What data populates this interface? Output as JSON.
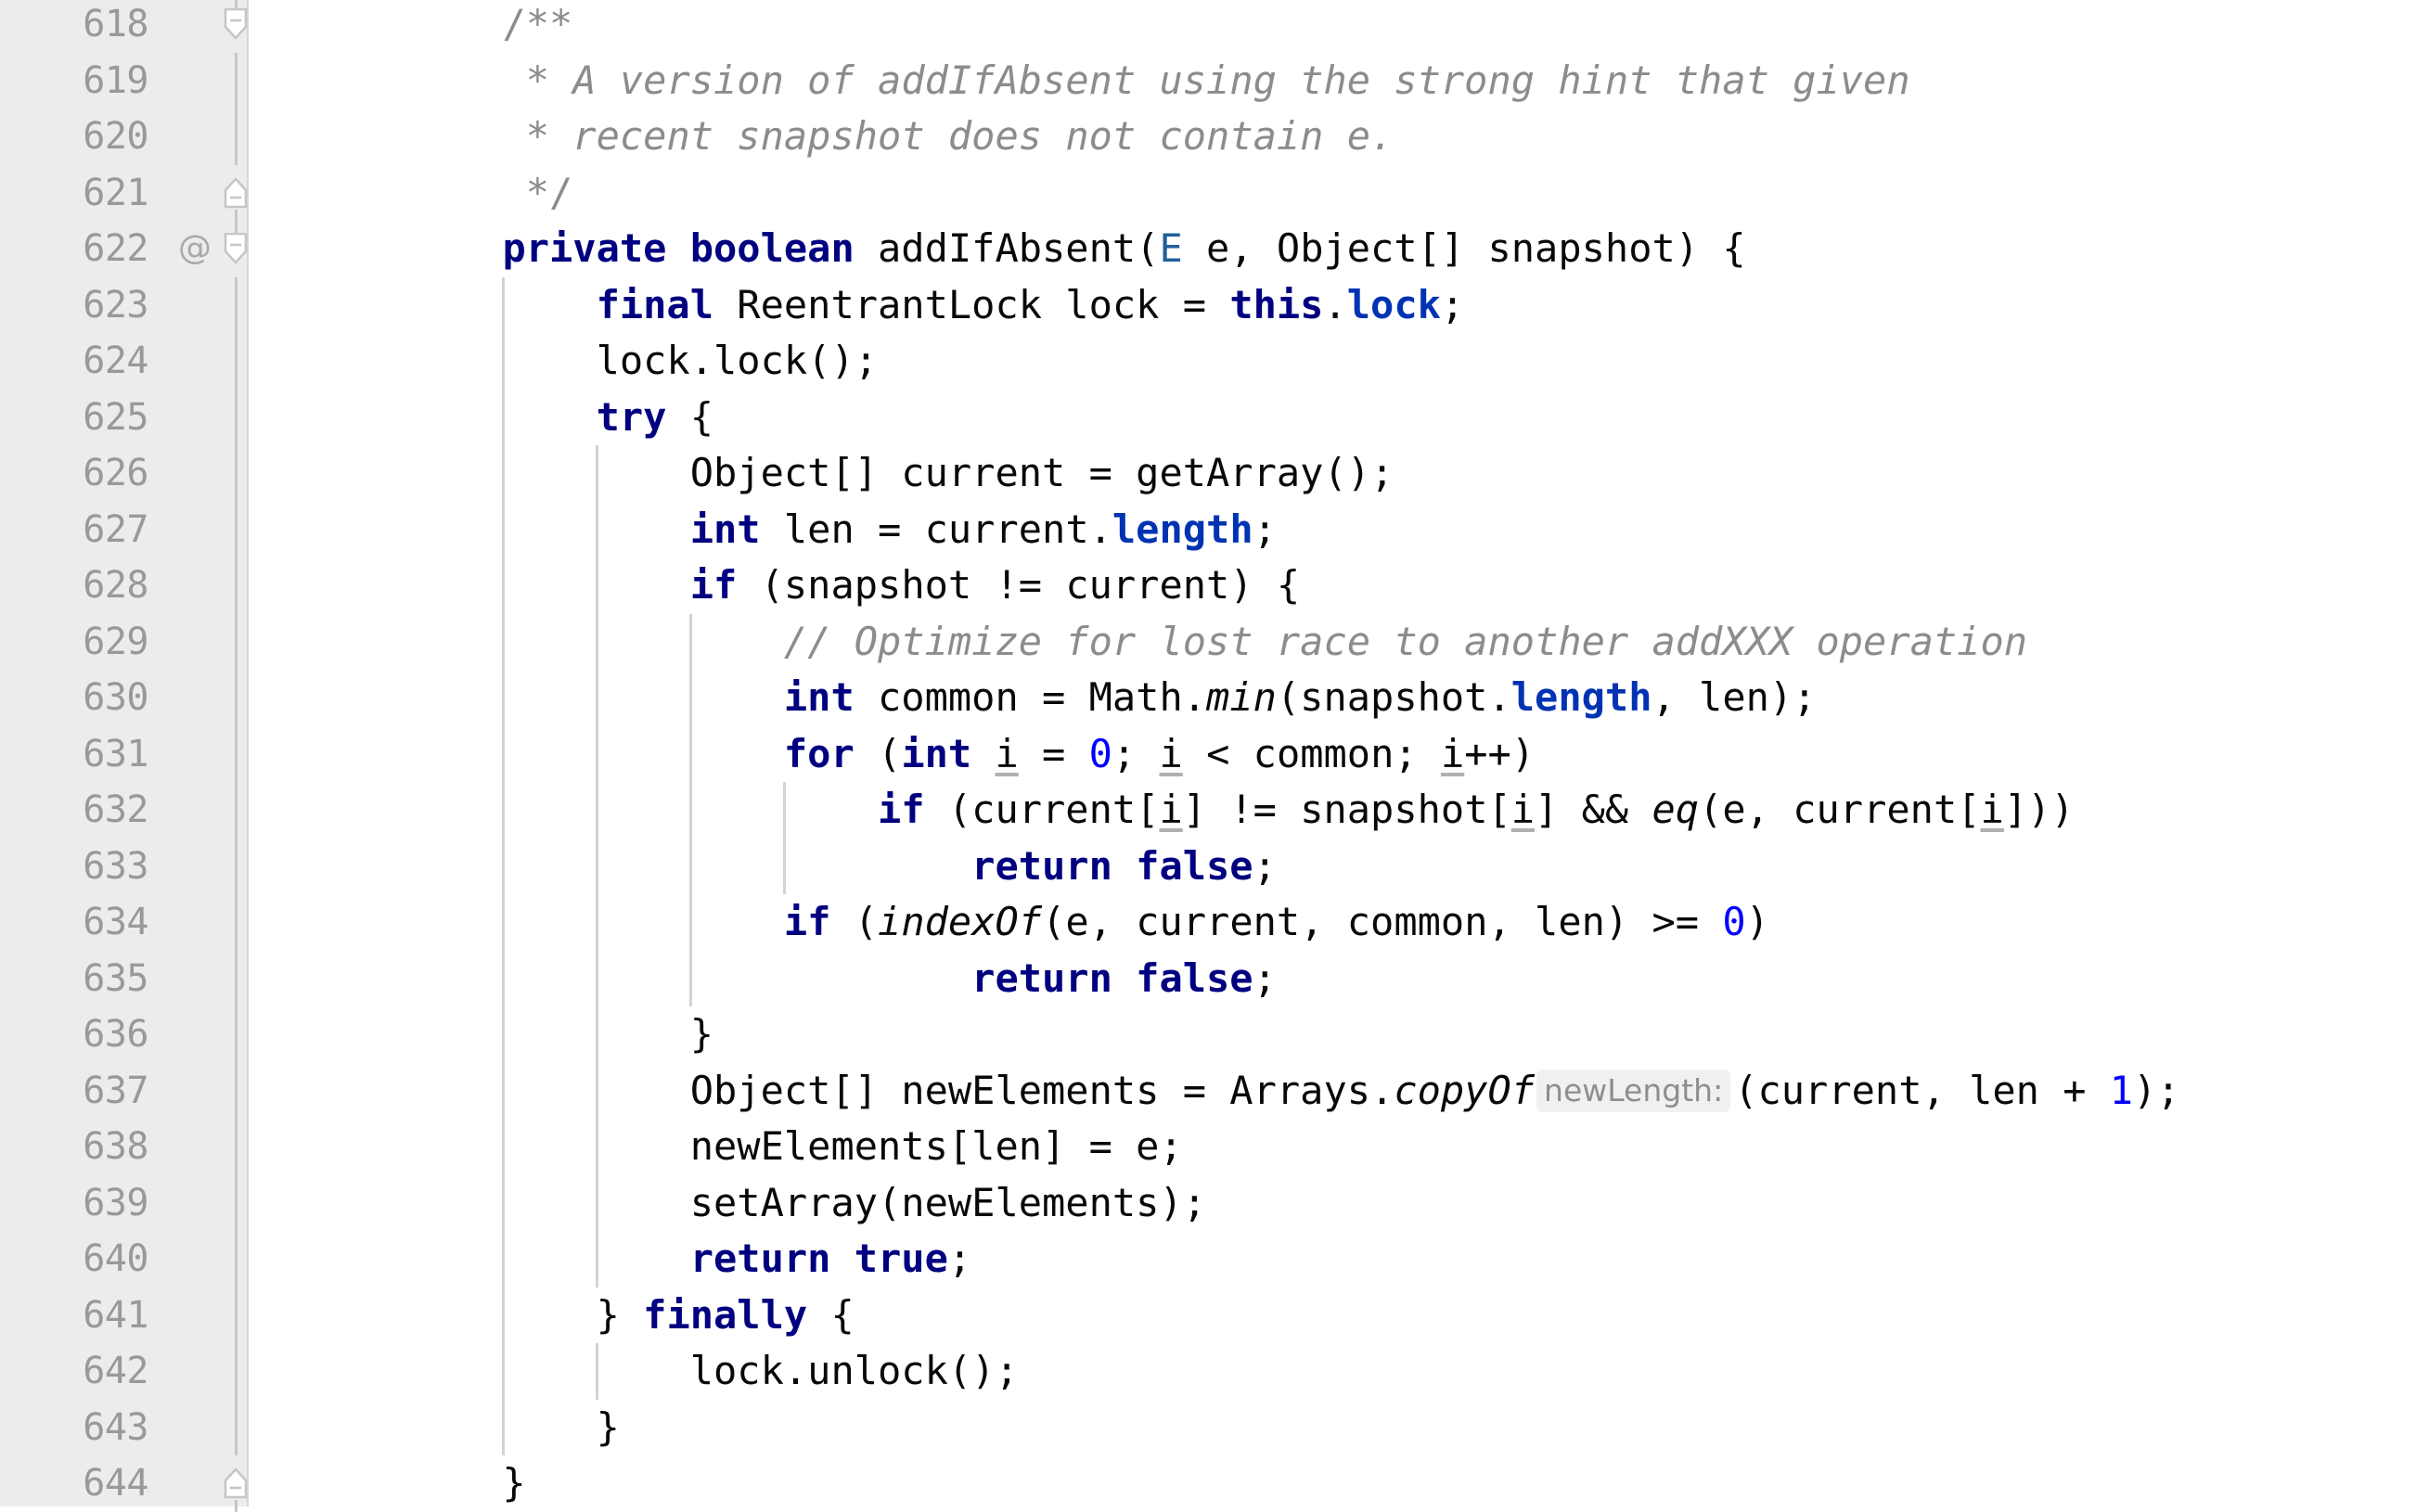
{
  "editor": {
    "language": "java",
    "theme": "light",
    "colors": {
      "gutter_bg": "#ececec",
      "gutter_fg": "#999999",
      "code_bg": "#ffffff",
      "code_fg": "#080808",
      "keyword": "#000080",
      "comment": "#8c8c8c",
      "number": "#0000ff",
      "field": "#0033b3",
      "type_parameter": "#20609a",
      "indent_guide": "#d3d3d3",
      "fold_marker": "#c6c6c6",
      "inlay_bg": "#f0f0f0",
      "inlay_fg": "#8e8e8e"
    },
    "first_line_number": 618,
    "last_line_number": 644,
    "gutter_markers": {
      "annotation_icon": "@",
      "annotation_icon_line": 622,
      "fold_minus_icon": "−"
    },
    "lines": [
      {
        "number": "618",
        "indent_guides": [],
        "fold": "start-down",
        "at": false,
        "tokens": [
          {
            "t": "            ",
            "c": "plain"
          },
          {
            "t": "/**",
            "c": "cmt-nb"
          }
        ]
      },
      {
        "number": "619",
        "indent_guides": [],
        "fold": "line",
        "at": false,
        "tokens": [
          {
            "t": "             ",
            "c": "plain"
          },
          {
            "t": "* A version of addIfAbsent using the strong hint that given",
            "c": "cmt"
          }
        ]
      },
      {
        "number": "620",
        "indent_guides": [],
        "fold": "line",
        "at": false,
        "tokens": [
          {
            "t": "             ",
            "c": "plain"
          },
          {
            "t": "* recent snapshot does not contain e.",
            "c": "cmt"
          }
        ]
      },
      {
        "number": "621",
        "indent_guides": [],
        "fold": "end-up",
        "at": false,
        "tokens": [
          {
            "t": "             ",
            "c": "plain"
          },
          {
            "t": "*/",
            "c": "cmt-nb"
          }
        ]
      },
      {
        "number": "622",
        "indent_guides": [],
        "fold": "start-down",
        "at": true,
        "tokens": [
          {
            "t": "            ",
            "c": "plain"
          },
          {
            "t": "private boolean",
            "c": "kw"
          },
          {
            "t": " addIfAbsent(",
            "c": "plain"
          },
          {
            "t": "E",
            "c": "typaram"
          },
          {
            "t": " e, Object[] snapshot) {",
            "c": "plain"
          }
        ]
      },
      {
        "number": "623",
        "indent_guides": [
          1
        ],
        "fold": "line",
        "at": false,
        "tokens": [
          {
            "t": "                ",
            "c": "plain"
          },
          {
            "t": "final",
            "c": "kw"
          },
          {
            "t": " ReentrantLock lock = ",
            "c": "plain"
          },
          {
            "t": "this",
            "c": "kw"
          },
          {
            "t": ".",
            "c": "plain"
          },
          {
            "t": "lock",
            "c": "field"
          },
          {
            "t": ";",
            "c": "plain"
          }
        ]
      },
      {
        "number": "624",
        "indent_guides": [
          1
        ],
        "fold": "line",
        "at": false,
        "tokens": [
          {
            "t": "                lock.lock();",
            "c": "plain"
          }
        ]
      },
      {
        "number": "625",
        "indent_guides": [
          1
        ],
        "fold": "line",
        "at": false,
        "tokens": [
          {
            "t": "                ",
            "c": "plain"
          },
          {
            "t": "try",
            "c": "kw"
          },
          {
            "t": " {",
            "c": "plain"
          }
        ]
      },
      {
        "number": "626",
        "indent_guides": [
          1,
          2
        ],
        "fold": "line",
        "at": false,
        "tokens": [
          {
            "t": "                    Object[] current = getArray();",
            "c": "plain"
          }
        ]
      },
      {
        "number": "627",
        "indent_guides": [
          1,
          2
        ],
        "fold": "line",
        "at": false,
        "tokens": [
          {
            "t": "                    ",
            "c": "plain"
          },
          {
            "t": "int",
            "c": "kw"
          },
          {
            "t": " len = current.",
            "c": "plain"
          },
          {
            "t": "length",
            "c": "field"
          },
          {
            "t": ";",
            "c": "plain"
          }
        ]
      },
      {
        "number": "628",
        "indent_guides": [
          1,
          2
        ],
        "fold": "line",
        "at": false,
        "tokens": [
          {
            "t": "                    ",
            "c": "plain"
          },
          {
            "t": "if",
            "c": "kw"
          },
          {
            "t": " (snapshot != current) {",
            "c": "plain"
          }
        ]
      },
      {
        "number": "629",
        "indent_guides": [
          1,
          2,
          3
        ],
        "fold": "line",
        "at": false,
        "tokens": [
          {
            "t": "                        ",
            "c": "plain"
          },
          {
            "t": "// Optimize for lost race to another addXXX operation",
            "c": "cmt"
          }
        ]
      },
      {
        "number": "630",
        "indent_guides": [
          1,
          2,
          3
        ],
        "fold": "line",
        "at": false,
        "tokens": [
          {
            "t": "                        ",
            "c": "plain"
          },
          {
            "t": "int",
            "c": "kw"
          },
          {
            "t": " common = Math.",
            "c": "plain"
          },
          {
            "t": "min",
            "c": "statm"
          },
          {
            "t": "(snapshot.",
            "c": "plain"
          },
          {
            "t": "length",
            "c": "field"
          },
          {
            "t": ", len);",
            "c": "plain"
          }
        ]
      },
      {
        "number": "631",
        "indent_guides": [
          1,
          2,
          3
        ],
        "fold": "line",
        "at": false,
        "tokens": [
          {
            "t": "                        ",
            "c": "plain"
          },
          {
            "t": "for",
            "c": "kw"
          },
          {
            "t": " (",
            "c": "plain"
          },
          {
            "t": "int",
            "c": "kw"
          },
          {
            "t": " ",
            "c": "plain"
          },
          {
            "t": "i",
            "c": "localv"
          },
          {
            "t": " = ",
            "c": "plain"
          },
          {
            "t": "0",
            "c": "num"
          },
          {
            "t": "; ",
            "c": "plain"
          },
          {
            "t": "i",
            "c": "localv"
          },
          {
            "t": " < common; ",
            "c": "plain"
          },
          {
            "t": "i",
            "c": "localv"
          },
          {
            "t": "++)",
            "c": "plain"
          }
        ]
      },
      {
        "number": "632",
        "indent_guides": [
          1,
          2,
          3,
          4
        ],
        "fold": "line",
        "at": false,
        "tokens": [
          {
            "t": "                            ",
            "c": "plain"
          },
          {
            "t": "if",
            "c": "kw"
          },
          {
            "t": " (current[",
            "c": "plain"
          },
          {
            "t": "i",
            "c": "localv"
          },
          {
            "t": "] != snapshot[",
            "c": "plain"
          },
          {
            "t": "i",
            "c": "localv"
          },
          {
            "t": "] && ",
            "c": "plain"
          },
          {
            "t": "eq",
            "c": "statm"
          },
          {
            "t": "(e, current[",
            "c": "plain"
          },
          {
            "t": "i",
            "c": "localv"
          },
          {
            "t": "]))",
            "c": "plain"
          }
        ]
      },
      {
        "number": "633",
        "indent_guides": [
          1,
          2,
          3,
          4
        ],
        "fold": "line",
        "at": false,
        "tokens": [
          {
            "t": "                                ",
            "c": "plain"
          },
          {
            "t": "return false",
            "c": "kw"
          },
          {
            "t": ";",
            "c": "plain"
          }
        ]
      },
      {
        "number": "634",
        "indent_guides": [
          1,
          2,
          3
        ],
        "fold": "line",
        "at": false,
        "tokens": [
          {
            "t": "                        ",
            "c": "plain"
          },
          {
            "t": "if",
            "c": "kw"
          },
          {
            "t": " (",
            "c": "plain"
          },
          {
            "t": "indexOf",
            "c": "statm"
          },
          {
            "t": "(e, current, common, len) >= ",
            "c": "plain"
          },
          {
            "t": "0",
            "c": "num"
          },
          {
            "t": ")",
            "c": "plain"
          }
        ]
      },
      {
        "number": "635",
        "indent_guides": [
          1,
          2,
          3
        ],
        "fold": "line",
        "at": false,
        "tokens": [
          {
            "t": "                                ",
            "c": "plain"
          },
          {
            "t": "return false",
            "c": "kw"
          },
          {
            "t": ";",
            "c": "plain"
          }
        ]
      },
      {
        "number": "636",
        "indent_guides": [
          1,
          2
        ],
        "fold": "line",
        "at": false,
        "tokens": [
          {
            "t": "                    }",
            "c": "plain"
          }
        ]
      },
      {
        "number": "637",
        "indent_guides": [
          1,
          2
        ],
        "fold": "line",
        "at": false,
        "inlay": {
          "after_token": 1,
          "text": "newLength:"
        },
        "tokens": [
          {
            "t": "                    Object[] newElements = Arrays.",
            "c": "plain"
          },
          {
            "t": "copyOf",
            "c": "statm"
          },
          {
            "t": "(current, ",
            "c": "plain"
          },
          {
            "t": "len + ",
            "c": "plain"
          },
          {
            "t": "1",
            "c": "num"
          },
          {
            "t": ");",
            "c": "plain"
          }
        ]
      },
      {
        "number": "638",
        "indent_guides": [
          1,
          2
        ],
        "fold": "line",
        "at": false,
        "tokens": [
          {
            "t": "                    newElements[len] = e;",
            "c": "plain"
          }
        ]
      },
      {
        "number": "639",
        "indent_guides": [
          1,
          2
        ],
        "fold": "line",
        "at": false,
        "tokens": [
          {
            "t": "                    setArray(newElements);",
            "c": "plain"
          }
        ]
      },
      {
        "number": "640",
        "indent_guides": [
          1,
          2
        ],
        "fold": "line",
        "at": false,
        "tokens": [
          {
            "t": "                    ",
            "c": "plain"
          },
          {
            "t": "return true",
            "c": "kw"
          },
          {
            "t": ";",
            "c": "plain"
          }
        ]
      },
      {
        "number": "641",
        "indent_guides": [
          1
        ],
        "fold": "line",
        "at": false,
        "tokens": [
          {
            "t": "                } ",
            "c": "plain"
          },
          {
            "t": "finally",
            "c": "kw"
          },
          {
            "t": " {",
            "c": "plain"
          }
        ]
      },
      {
        "number": "642",
        "indent_guides": [
          1,
          2
        ],
        "fold": "line",
        "at": false,
        "tokens": [
          {
            "t": "                    lock.unlock();",
            "c": "plain"
          }
        ]
      },
      {
        "number": "643",
        "indent_guides": [
          1
        ],
        "fold": "line",
        "at": false,
        "tokens": [
          {
            "t": "                }",
            "c": "plain"
          }
        ]
      },
      {
        "number": "644",
        "indent_guides": [],
        "fold": "end-up",
        "at": false,
        "tokens": [
          {
            "t": "            }",
            "c": "plain"
          }
        ]
      }
    ]
  }
}
